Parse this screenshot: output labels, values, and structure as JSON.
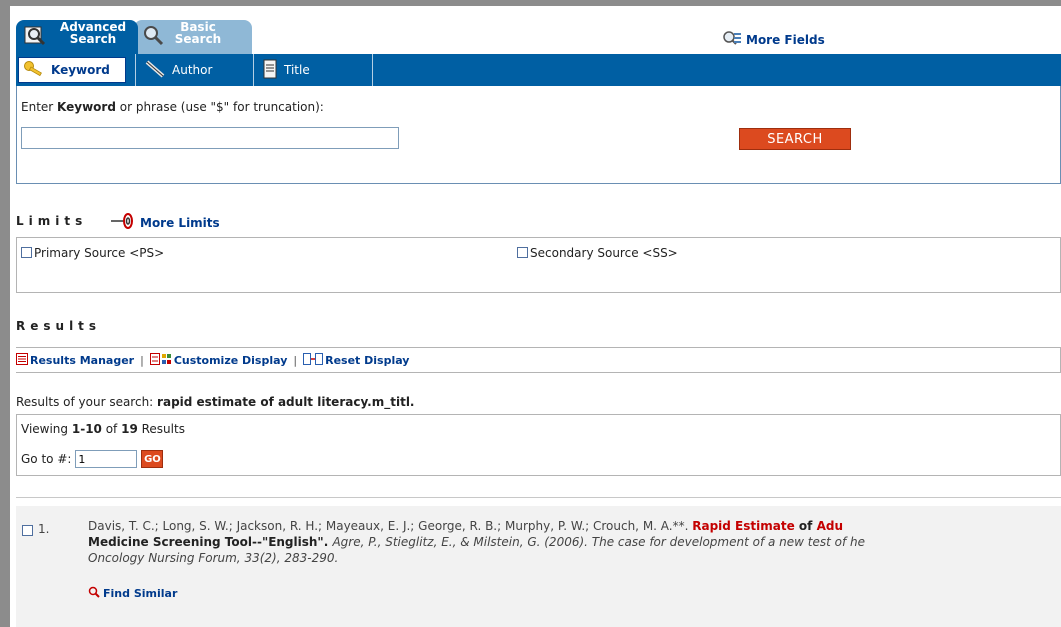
{
  "tabs": {
    "advanced_line1": "Advanced",
    "advanced_line2": "Search",
    "basic_line1": "Basic",
    "basic_line2": "Search"
  },
  "more_fields": "More Fields",
  "search_types": {
    "keyword": "Keyword",
    "author": "Author",
    "title": "Title"
  },
  "keyword_panel": {
    "prompt_prefix": "Enter ",
    "prompt_bold": "Keyword",
    "prompt_suffix": " or phrase (use \"$\" for truncation):",
    "input_value": "",
    "search_button": "SEARCH"
  },
  "limits": {
    "heading": "Limits",
    "more_limits": "More Limits",
    "options": [
      "Primary Source <PS>",
      "Secondary Source <SS>"
    ]
  },
  "results": {
    "heading": "Results",
    "toolbar": {
      "manager": "Results Manager",
      "customize": "Customize Display",
      "reset": "Reset Display",
      "separator": "|"
    },
    "query_prefix": "Results of your search: ",
    "query": "rapid estimate of adult literacy.m_titl.",
    "viewing_prefix": "Viewing ",
    "viewing_range": "1-10",
    "viewing_of": " of ",
    "viewing_total": "19",
    "viewing_suffix": " Results",
    "goto_label": "Go to #:",
    "goto_value": "1",
    "go_button": "GO"
  },
  "record": {
    "number": "1.",
    "authors": "Davis, T. C.; Long, S. W.; Jackson, R. H.; Mayeaux, E. J.; George, R. B.; Murphy, P. W.; Crouch, M. A.**. ",
    "title_highlight": "Rapid Estimate",
    "title_of": " of ",
    "title_tail": "Adu",
    "line2_bold": "Medicine Screening Tool--\"English\". ",
    "line2_italic": "Agre, P., Stieglitz, E., & Milstein, G. (2006). The case for development of a new test of he",
    "line3_italic": "Oncology Nursing Forum, 33(2), 283-290.",
    "find_similar": "Find Similar"
  },
  "colors": {
    "brand_blue": "#005fa3",
    "link_blue": "#003a8c",
    "action_orange": "#dc4a1f",
    "highlight_red": "#c40000"
  }
}
